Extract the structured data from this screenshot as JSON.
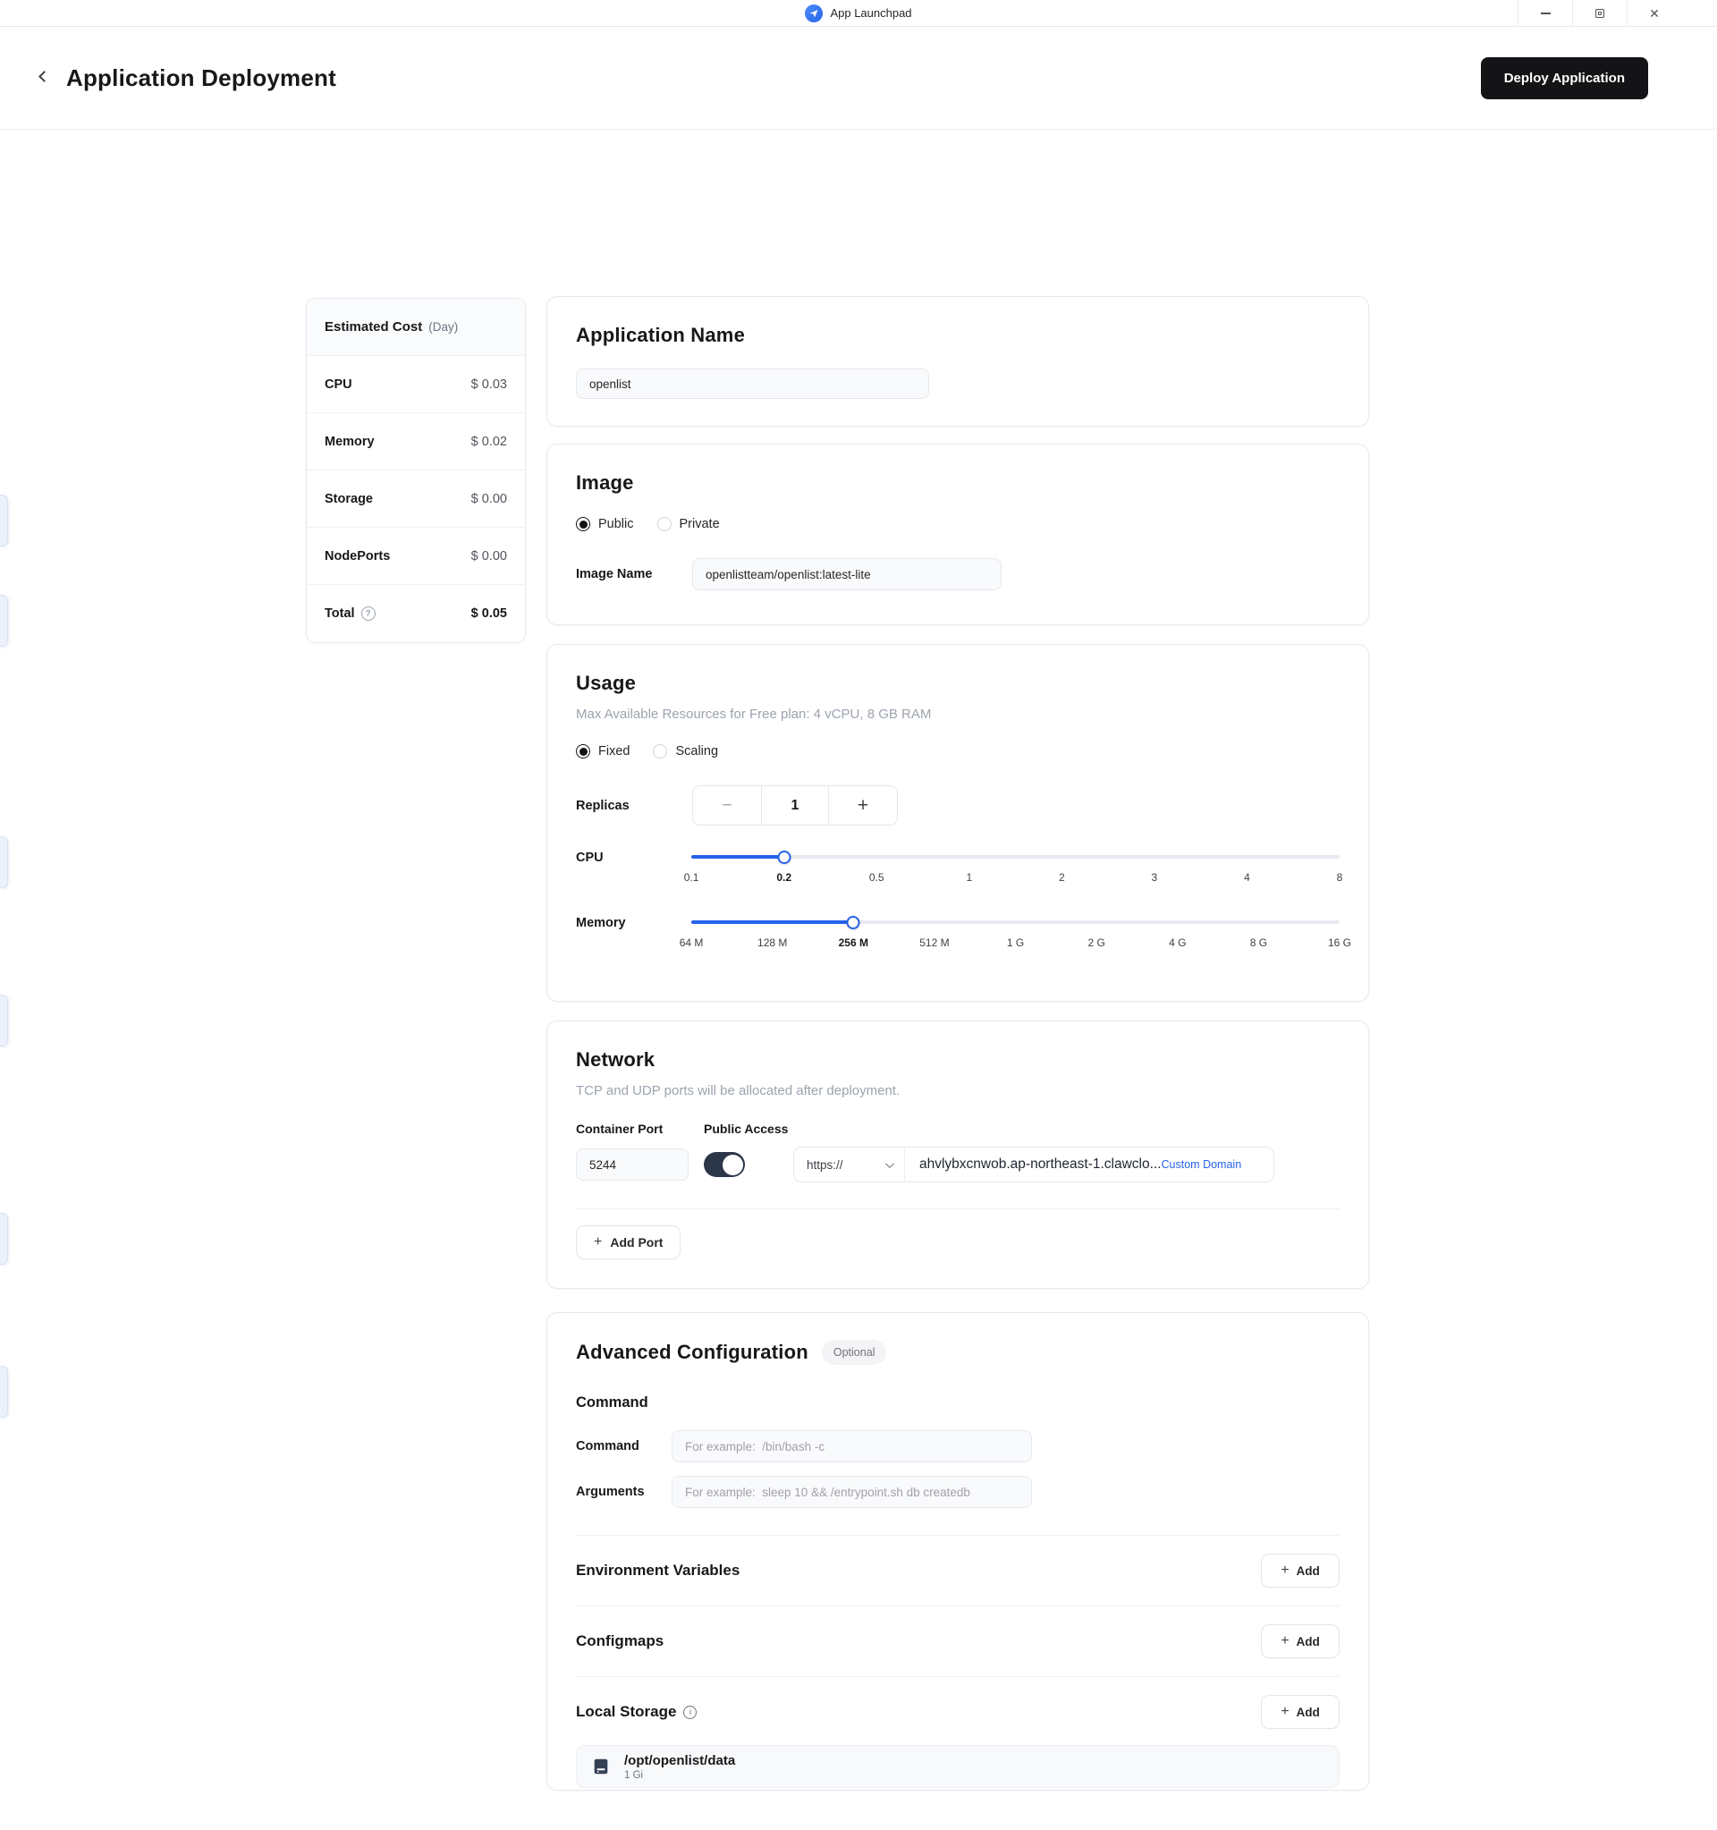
{
  "titlebar": {
    "app_name": "App Launchpad"
  },
  "icons": {
    "plus": "+",
    "minus": "−",
    "close": "✕",
    "question": "?",
    "info": "i"
  },
  "header": {
    "title": "Application Deployment",
    "deploy_label": "Deploy Application"
  },
  "cost": {
    "header_label": "Estimated Cost",
    "header_unit": "(Day)",
    "rows": [
      {
        "label": "CPU",
        "value": "$ 0.03"
      },
      {
        "label": "Memory",
        "value": "$ 0.02"
      },
      {
        "label": "Storage",
        "value": "$ 0.00"
      },
      {
        "label": "NodePorts",
        "value": "$ 0.00"
      }
    ],
    "total_label": "Total",
    "total_value": "$ 0.05"
  },
  "app_name_card": {
    "title": "Application Name",
    "value": "openlist"
  },
  "image_card": {
    "title": "Image",
    "public_label": "Public",
    "private_label": "Private",
    "image_name_label": "Image Name",
    "image_name_value": "openlistteam/openlist:latest-lite"
  },
  "usage_card": {
    "title": "Usage",
    "subtitle": "Max Available Resources for Free plan: 4 vCPU, 8 GB RAM",
    "fixed_label": "Fixed",
    "scaling_label": "Scaling",
    "replicas_label": "Replicas",
    "replicas_value": "1",
    "cpu": {
      "label": "CPU",
      "ticks": [
        "0.1",
        "0.2",
        "0.5",
        "1",
        "2",
        "3",
        "4",
        "8"
      ],
      "selected_index": 1,
      "selected_value": "0.2"
    },
    "memory": {
      "label": "Memory",
      "ticks": [
        "64 M",
        "128 M",
        "256 M",
        "512 M",
        "1 G",
        "2 G",
        "4 G",
        "8 G",
        "16 G"
      ],
      "selected_index": 2,
      "selected_value": "256 M"
    }
  },
  "network_card": {
    "title": "Network",
    "subtitle": "TCP and UDP ports will be allocated after deployment.",
    "container_port_label": "Container Port",
    "public_access_label": "Public Access",
    "port_value": "5244",
    "public_access_on": true,
    "protocol": "https://",
    "domain": "ahvlybxcnwob.ap-northeast-1.clawclo...",
    "custom_domain_label": "Custom Domain",
    "add_port_label": "Add Port"
  },
  "advanced_card": {
    "title": "Advanced Configuration",
    "optional_badge": "Optional",
    "command_heading": "Command",
    "command_label": "Command",
    "command_placeholder": "For example:  /bin/bash -c",
    "arguments_label": "Arguments",
    "arguments_placeholder": "For example:  sleep 10 && /entrypoint.sh db createdb",
    "env_title": "Environment Variables",
    "configmaps_title": "Configmaps",
    "local_storage_title": "Local Storage",
    "add_label": "Add",
    "storage_item": {
      "path": "/opt/openlist/data",
      "size": "1 Gi"
    }
  }
}
